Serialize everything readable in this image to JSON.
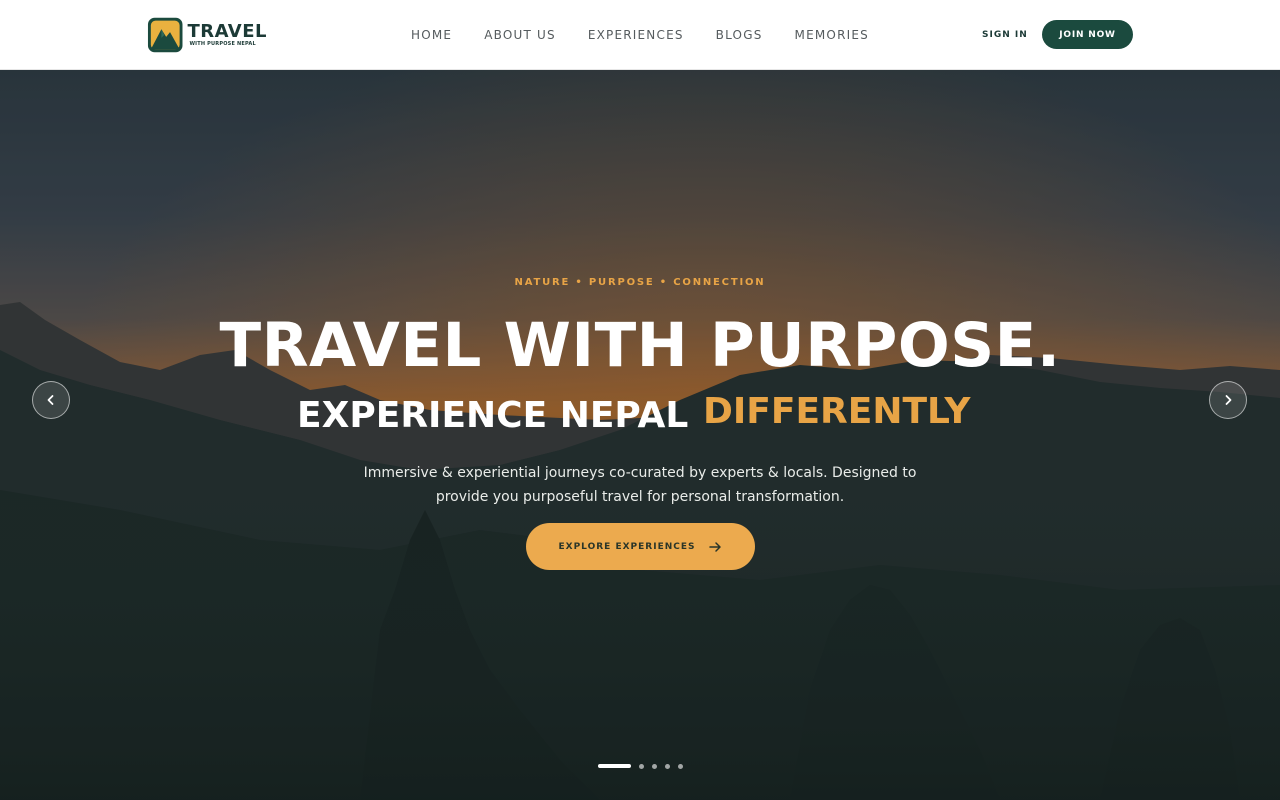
{
  "brand": {
    "title": "TRAVEL",
    "subtitle": "WITH PURPOSE NEPAL",
    "colors": {
      "primary": "#1b4a3e",
      "accent": "#e8a446",
      "logo_bg": "#e9b13f"
    }
  },
  "nav": {
    "items": [
      {
        "label": "HOME"
      },
      {
        "label": "ABOUT US"
      },
      {
        "label": "EXPERIENCES"
      },
      {
        "label": "BLOGS"
      },
      {
        "label": "MEMORIES"
      }
    ]
  },
  "auth": {
    "sign_in": "SIGN IN",
    "join": "JOIN NOW"
  },
  "hero": {
    "tagline": "NATURE • PURPOSE • CONNECTION",
    "title": "TRAVEL WITH PURPOSE.",
    "subtitle_white": "EXPERIENCE NEPAL",
    "subtitle_accent": "DIFFERENTLY",
    "description": "Immersive & experiential journeys co-curated by experts & locals. Designed to provide you purposeful travel for personal transformation.",
    "cta": {
      "label": "EXPLORE EXPERIENCES",
      "icon": "arrow-right-icon"
    },
    "prev_icon": "chevron-left-icon",
    "next_icon": "chevron-right-icon",
    "slides_total": 5,
    "active_slide": 1
  }
}
